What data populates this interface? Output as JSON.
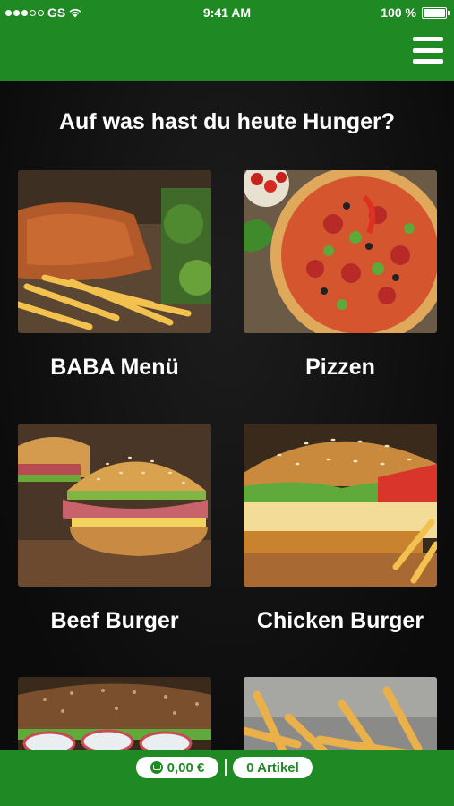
{
  "status_bar": {
    "carrier": "GS",
    "time": "9:41 AM",
    "battery": "100 %"
  },
  "header": {
    "menu_icon": "hamburger-menu-icon"
  },
  "main": {
    "headline": "Auf was hast du heute Hunger?",
    "categories": [
      {
        "label": "BABA Menü",
        "image": "schnitzel-fries-photo"
      },
      {
        "label": "Pizzen",
        "image": "pizza-photo"
      },
      {
        "label": "Beef Burger",
        "image": "beef-burger-photo"
      },
      {
        "label": "Chicken Burger",
        "image": "chicken-burger-photo"
      },
      {
        "label": "",
        "image": "sub-sandwich-photo"
      },
      {
        "label": "",
        "image": "french-fries-photo"
      }
    ]
  },
  "footer": {
    "cart_total": "0,00 €",
    "items_count": "0 Artikel"
  },
  "colors": {
    "brand_green": "#1f8a24",
    "background": "#0e0e0e",
    "text": "#ffffff"
  }
}
